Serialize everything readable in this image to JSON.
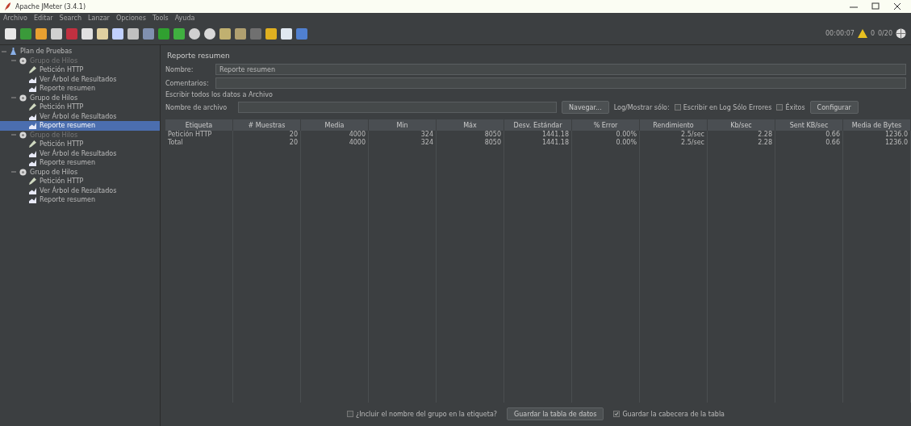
{
  "window": {
    "title": "Apache JMeter (3.4.1)"
  },
  "menu": [
    "Archivo",
    "Editar",
    "Search",
    "Lanzar",
    "Opciones",
    "Tools",
    "Ayuda"
  ],
  "status": {
    "timer": "00:00:07",
    "errors": "0",
    "threads": "0/20"
  },
  "tree": {
    "label": "Plan de Pruebas",
    "kind": "plan",
    "enabled": true,
    "selected": false,
    "expanded": true,
    "children": [
      {
        "label": "Grupo de Hilos",
        "kind": "group",
        "enabled": false,
        "selected": false,
        "expanded": true,
        "children": [
          {
            "label": "Petición HTTP",
            "kind": "sampler",
            "enabled": true,
            "selected": false
          },
          {
            "label": "Ver Árbol de Resultados",
            "kind": "listener",
            "enabled": true,
            "selected": false
          },
          {
            "label": "Reporte resumen",
            "kind": "listener",
            "enabled": true,
            "selected": false
          }
        ]
      },
      {
        "label": "Grupo de Hilos",
        "kind": "group",
        "enabled": true,
        "selected": false,
        "expanded": true,
        "children": [
          {
            "label": "Petición HTTP",
            "kind": "sampler",
            "enabled": true,
            "selected": false
          },
          {
            "label": "Ver Árbol de Resultados",
            "kind": "listener",
            "enabled": true,
            "selected": false
          },
          {
            "label": "Reporte resumen",
            "kind": "listener",
            "enabled": true,
            "selected": true
          }
        ]
      },
      {
        "label": "Grupo de Hilos",
        "kind": "group",
        "enabled": false,
        "selected": false,
        "expanded": true,
        "children": [
          {
            "label": "Petición HTTP",
            "kind": "sampler",
            "enabled": true,
            "selected": false
          },
          {
            "label": "Ver Árbol de Resultados",
            "kind": "listener",
            "enabled": true,
            "selected": false
          },
          {
            "label": "Reporte resumen",
            "kind": "listener",
            "enabled": true,
            "selected": false
          }
        ]
      },
      {
        "label": "Grupo de Hilos",
        "kind": "group",
        "enabled": true,
        "selected": false,
        "expanded": true,
        "children": [
          {
            "label": "Petición HTTP",
            "kind": "sampler",
            "enabled": true,
            "selected": false
          },
          {
            "label": "Ver Árbol de Resultados",
            "kind": "listener",
            "enabled": true,
            "selected": false
          },
          {
            "label": "Reporte resumen",
            "kind": "listener",
            "enabled": true,
            "selected": false
          }
        ]
      }
    ]
  },
  "panel": {
    "title": "Reporte resumen",
    "name_label": "Nombre:",
    "name_value": "Reporte resumen",
    "comments_label": "Comentarios:",
    "file_section": "Escribir todos los datos a Archivo",
    "file_label": "Nombre de archivo",
    "browse": "Navegar...",
    "log_label": "Log/Mostrar sólo:",
    "checks": [
      {
        "label": "Escribir en Log Sólo Errores",
        "checked": false
      },
      {
        "label": "Éxitos",
        "checked": false
      }
    ],
    "configure": "Configurar"
  },
  "table": {
    "columns": [
      "Etiqueta",
      "# Muestras",
      "Media",
      "Min",
      "Máx",
      "Desv. Estándar",
      "% Error",
      "Rendimiento",
      "Kb/sec",
      "Sent KB/sec",
      "Media de Bytes"
    ],
    "rows": [
      [
        "Petición HTTP",
        "20",
        "4000",
        "324",
        "8050",
        "1441.18",
        "0.00%",
        "2.5/sec",
        "2.28",
        "0.66",
        "1236.0"
      ],
      [
        "Total",
        "20",
        "4000",
        "324",
        "8050",
        "1441.18",
        "0.00%",
        "2.5/sec",
        "2.28",
        "0.66",
        "1236.0"
      ]
    ]
  },
  "footer": {
    "include_group": {
      "label": "¿Incluir el nombre del grupo en la etiqueta?",
      "checked": false
    },
    "save_table": "Guardar la tabla de datos",
    "save_header": {
      "label": "Guardar la cabecera de la tabla",
      "checked": true
    }
  }
}
